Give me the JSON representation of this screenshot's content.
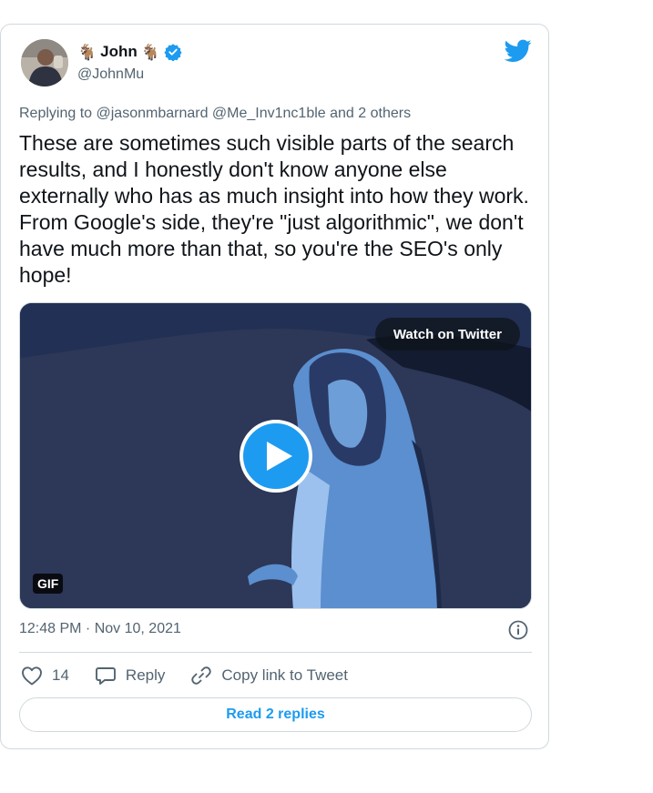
{
  "author": {
    "display_name": "John",
    "emoji_left": "🐐",
    "emoji_right": "🐐",
    "handle": "@JohnMu",
    "verified": true
  },
  "replying_to": "Replying to @jasonmbarnard @Me_Inv1nc1ble and 2 others",
  "tweet_text": "These are sometimes such visible parts of the search results, and I honestly don't know anyone else externally who has as much insight into how they work. From Google's side, they're \"just algorithmic\", we don't have much more than that, so you're the SEO's only hope!",
  "media": {
    "watch_label": "Watch on Twitter",
    "badge": "GIF"
  },
  "timestamp": "12:48 PM · Nov 10, 2021",
  "actions": {
    "like_count": "14",
    "reply_label": "Reply",
    "copy_label": "Copy link to Tweet"
  },
  "read_replies_label": "Read 2 replies",
  "colors": {
    "accent": "#1d9bf0",
    "text": "#0f1419",
    "muted": "#536471",
    "border": "#cfd9de"
  }
}
